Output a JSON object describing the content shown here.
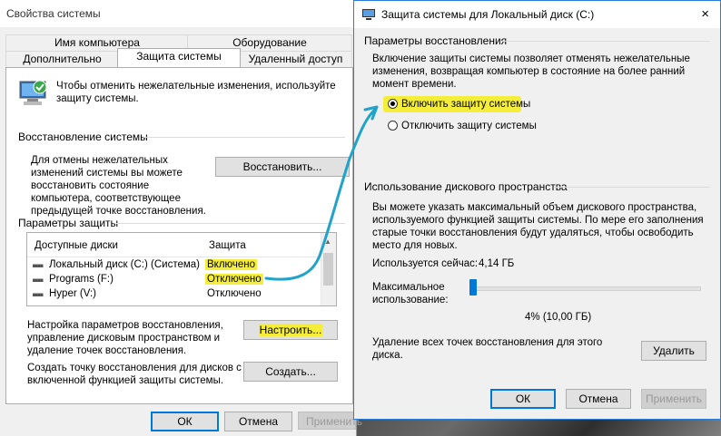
{
  "bg_window": {
    "title": "Свойства системы",
    "tabs_row1": [
      "Имя компьютера",
      "Оборудование"
    ],
    "tabs_row2": [
      "Дополнительно",
      "Защита системы",
      "Удаленный доступ"
    ],
    "info_text": "Чтобы отменить нежелательные изменения, используйте защиту системы.",
    "restore_header": "Восстановление системы",
    "restore_text": "Для отмены нежелательных изменений системы вы можете восстановить состояние компьютера, соответствующее предыдущей точке восстановления.",
    "restore_button": "Восстановить...",
    "protection_header": "Параметры защиты",
    "list_headers": {
      "drives": "Доступные диски",
      "protection": "Защита"
    },
    "drives": [
      {
        "name": "Локальный диск (C:) (Система)",
        "status": "Включено"
      },
      {
        "name": "Programs (F:)",
        "status": "Отключено"
      },
      {
        "name": "Hyper (V:)",
        "status": "Отключено"
      }
    ],
    "configure_text": "Настройка параметров восстановления, управление дисковым пространством и удаление точек восстановления.",
    "configure_button": "Настроить...",
    "create_text": "Создать точку восстановления для дисков с включенной функцией защиты системы.",
    "create_button": "Создать...",
    "ok": "ОК",
    "cancel": "Отмена",
    "apply": "Применить"
  },
  "fg_window": {
    "title": "Защита системы для Локальный диск (C:)",
    "close_icon": "×",
    "restore_params_header": "Параметры восстановления",
    "restore_params_text": "Включение защиты системы позволяет отменять нежелательные изменения, возвращая компьютер в состояние на более ранний момент времени.",
    "radio_enable": "Включить защиту системы",
    "radio_disable": "Отключить защиту системы",
    "disk_usage_header": "Использование дискового пространства",
    "disk_usage_text": "Вы можете указать максимальный объем дискового пространства, используемого функцией защиты системы. По мере его заполнения старые точки восстановления будут удаляться, чтобы освободить место для новых.",
    "current_usage_label": "Используется сейчас:",
    "current_usage_value": "4,14 ГБ",
    "max_usage_label": "Максимальное использование:",
    "max_usage_value": "4% (10,00 ГБ)",
    "slider_percent": 4,
    "delete_text": "Удаление всех точек восстановления для этого диска.",
    "delete_button": "Удалить",
    "ok": "ОК",
    "cancel": "Отмена",
    "apply": "Применить"
  },
  "colors": {
    "highlight": "#f4ee3a",
    "accent": "#0078d7",
    "arrow": "#1fa3c9"
  }
}
